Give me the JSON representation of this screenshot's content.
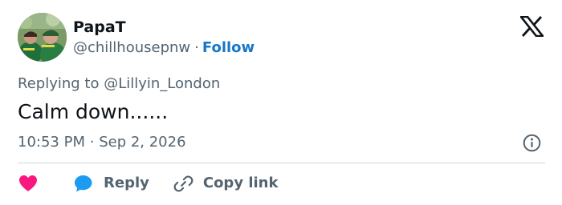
{
  "author": {
    "name": "PapaT",
    "handle": "@chillhousepnw",
    "separator": "·",
    "follow_label": "Follow",
    "avatar_icon": "avatar-photo"
  },
  "brand": {
    "logo_icon": "x-logo-icon"
  },
  "tweet": {
    "replying_to": "Replying to @Lillyin_London",
    "text": "Calm down......",
    "time": "10:53 PM",
    "timestamp_separator": "·",
    "date": "Sep 2, 2026"
  },
  "actions": {
    "like_icon": "heart-icon",
    "reply_icon": "speech-bubble-icon",
    "reply_label": "Reply",
    "copy_icon": "link-icon",
    "copy_label": "Copy link",
    "info_icon": "info-icon"
  },
  "colors": {
    "text_primary": "#0f1419",
    "text_secondary": "#536471",
    "follow_blue": "#1877c9",
    "like_pink": "#f91880",
    "reply_blue": "#1d9bf0",
    "divider": "#cfd9de"
  }
}
